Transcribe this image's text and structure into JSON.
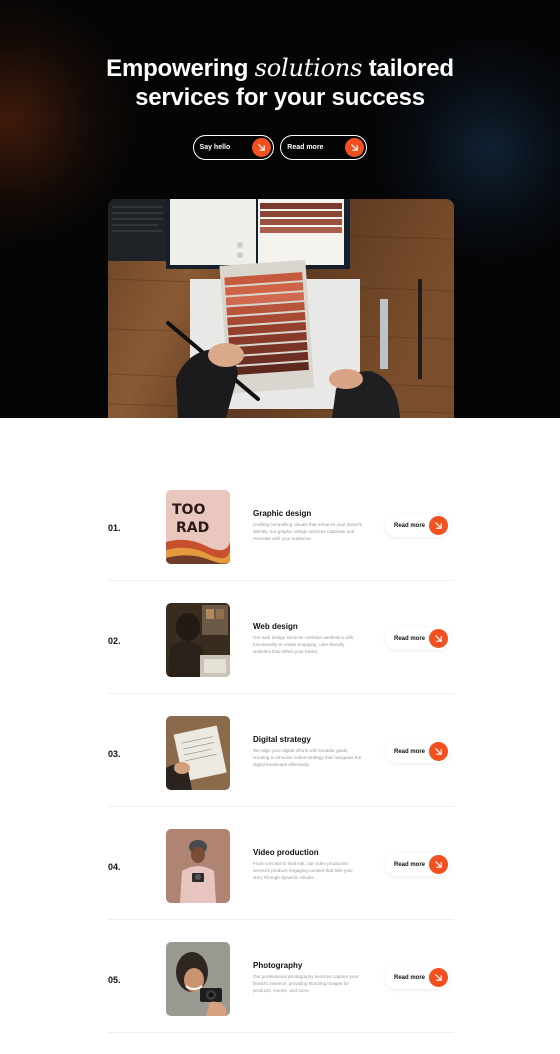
{
  "hero": {
    "title_part1": "Empowering",
    "title_italic": "solutions",
    "title_part2": "tailored",
    "title_line2": "services for your success",
    "btn_primary": "Say hello",
    "btn_secondary": "Read more"
  },
  "colors": {
    "accent": "#f2501e",
    "hero_bg": "#050506"
  },
  "services": [
    {
      "number": "01.",
      "title": "Graphic design",
      "description": "Crafting compelling visuals that enhance your brand's identity, our graphic design services captivate and resonate with your audience.",
      "cta": "Read more"
    },
    {
      "number": "02.",
      "title": "Web design",
      "description": "Our web design services combine aesthetics with functionality to create engaging, user-friendly websites that reflect your brand.",
      "cta": "Read more"
    },
    {
      "number": "03.",
      "title": "Digital strategy",
      "description": "We align your digital efforts with broader goals, creating a cohesive online strategy that navigates the digital landscape effectively.",
      "cta": "Read more"
    },
    {
      "number": "04.",
      "title": "Video production",
      "description": "From concept to final edit, our video production services produce engaging content that tells your story through dynamic visuals.",
      "cta": "Read more"
    },
    {
      "number": "05.",
      "title": "Photography",
      "description": "Our professional photography services capture your brand's essence, providing stunning images for products, events, and more.",
      "cta": "Read more"
    }
  ]
}
